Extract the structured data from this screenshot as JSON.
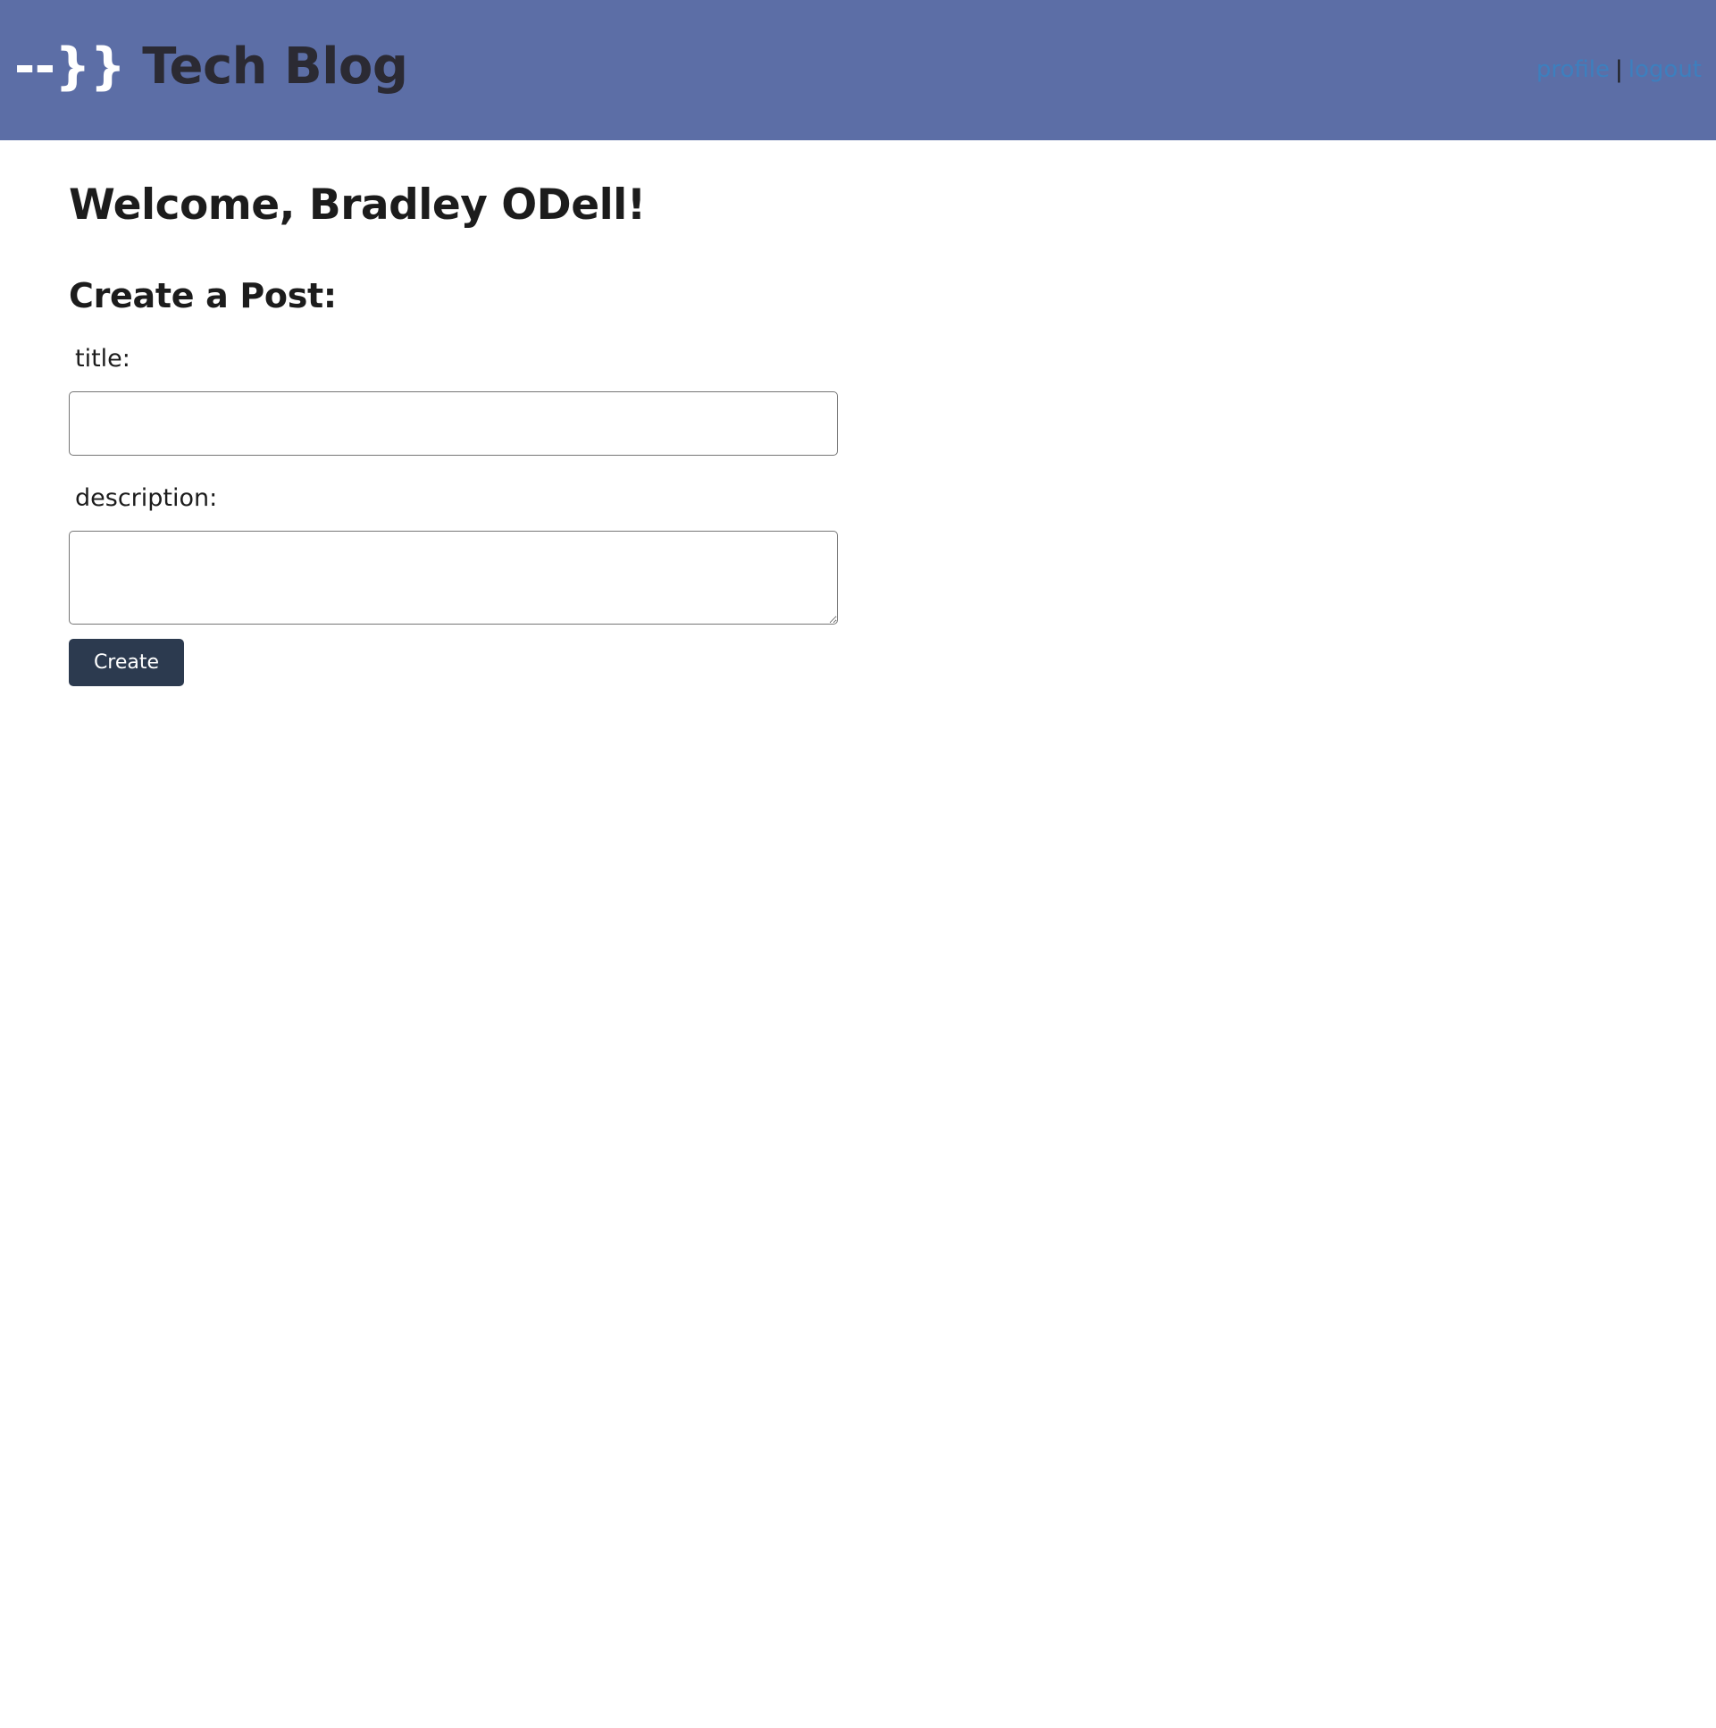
{
  "header": {
    "brand_mark": "--}}",
    "brand_name": "Tech Blog",
    "nav": {
      "profile_label": "profile",
      "separator": "|",
      "logout_label": "logout"
    }
  },
  "main": {
    "welcome_text": "Welcome, Bradley ODell!",
    "section_title": "Create a Post:",
    "form": {
      "title_label": "title:",
      "title_value": "",
      "description_label": "description:",
      "description_value": "",
      "submit_label": "Create"
    }
  },
  "colors": {
    "header_background": "#5c6ea6",
    "link": "#3d7fbe",
    "button_background": "#2c3a4f",
    "button_text": "#ffffff",
    "brand_mark": "#ffffff",
    "brand_name": "#2b2a33"
  }
}
